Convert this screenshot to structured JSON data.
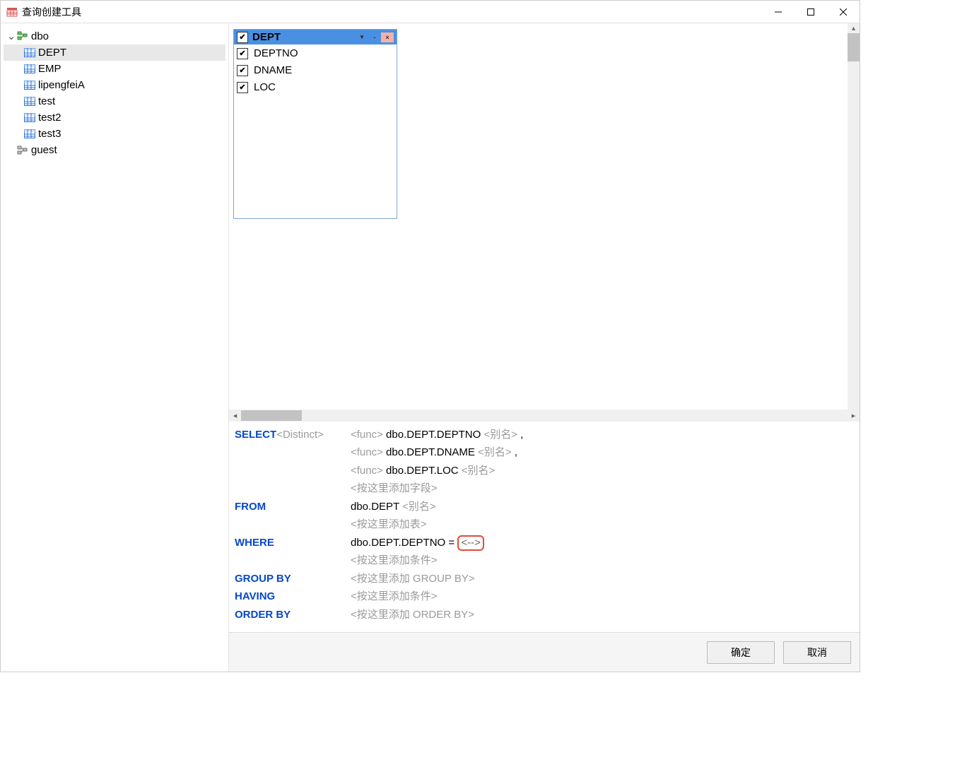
{
  "window": {
    "title": "查询创建工具"
  },
  "tree": {
    "root": {
      "name": "dbo",
      "icon": "schema"
    },
    "children": [
      {
        "name": "DEPT",
        "icon": "table",
        "selected": true
      },
      {
        "name": "EMP",
        "icon": "table"
      },
      {
        "name": "lipengfeiA",
        "icon": "table"
      },
      {
        "name": "test",
        "icon": "table"
      },
      {
        "name": "test2",
        "icon": "table"
      },
      {
        "name": "test3",
        "icon": "table"
      }
    ],
    "sibling": {
      "name": "guest",
      "icon": "schema-gray"
    }
  },
  "tableBox": {
    "title": "DEPT",
    "headerChecked": true,
    "columns": [
      {
        "name": "DEPTNO",
        "checked": true
      },
      {
        "name": "DNAME",
        "checked": true
      },
      {
        "name": "LOC",
        "checked": true
      }
    ]
  },
  "sql": {
    "select": {
      "kw": "SELECT",
      "distinct": "<Distinct>",
      "func": "<func>",
      "alias": "<别名>",
      "comma": " ,",
      "fields": [
        "dbo.DEPT.DEPTNO",
        "dbo.DEPT.DNAME",
        "dbo.DEPT.LOC"
      ],
      "addField": "<按这里添加字段>"
    },
    "from": {
      "kw": "FROM",
      "table": "dbo.DEPT",
      "alias": "<别名>",
      "addTable": "<按这里添加表>"
    },
    "where": {
      "kw": "WHERE",
      "field": "dbo.DEPT.DEPTNO",
      "op": " = ",
      "value": "<-->",
      "addCond": "<按这里添加条件>"
    },
    "groupby": {
      "kw": "GROUP BY",
      "hint": "<按这里添加 GROUP BY>"
    },
    "having": {
      "kw": "HAVING",
      "hint": "<按这里添加条件>"
    },
    "orderby": {
      "kw": "ORDER BY",
      "hint": "<按这里添加 ORDER BY>"
    }
  },
  "footer": {
    "ok": "确定",
    "cancel": "取消"
  }
}
